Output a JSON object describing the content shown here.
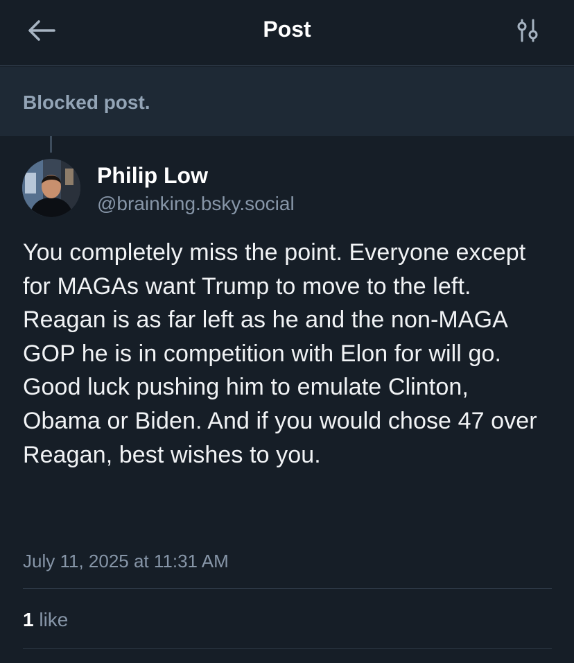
{
  "header": {
    "title": "Post",
    "back_icon": "arrow-left-icon",
    "filter_icon": "sliders-icon"
  },
  "blocked": {
    "text": "Blocked post."
  },
  "post": {
    "author_name": "Philip Low",
    "author_handle": "@brainking.bsky.social",
    "body": "You completely miss the point. Everyone except for MAGAs want Trump to move to the left. Reagan is as far left as he and the non-MAGA GOP he is in competition with Elon for will go. Good luck pushing him to emulate Clinton, Obama or Biden. And if you would chose 47 over Reagan, best wishes to you.",
    "timestamp": "July 11, 2025 at 11:31 AM",
    "like_count": "1",
    "like_label": "like"
  },
  "colors": {
    "background": "#161e27",
    "blocked_background": "#1e2935",
    "text_primary": "#ffffff",
    "text_secondary": "#8796a8"
  }
}
